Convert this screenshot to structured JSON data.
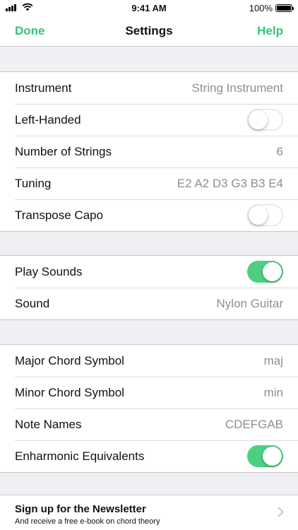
{
  "status_bar": {
    "time": "9:41 AM",
    "battery": "100%"
  },
  "nav": {
    "done": "Done",
    "title": "Settings",
    "help": "Help",
    "accent_color": "#2fc778"
  },
  "section1": {
    "instrument": {
      "label": "Instrument",
      "value": "String Instrument"
    },
    "left_handed": {
      "label": "Left-Handed",
      "on": false
    },
    "strings": {
      "label": "Number of Strings",
      "value": "6"
    },
    "tuning": {
      "label": "Tuning",
      "value": "E2 A2 D3 G3 B3 E4"
    },
    "transpose_capo": {
      "label": "Transpose Capo",
      "on": false
    }
  },
  "section2": {
    "play_sounds": {
      "label": "Play Sounds",
      "on": true
    },
    "sound": {
      "label": "Sound",
      "value": "Nylon Guitar"
    }
  },
  "section3": {
    "major": {
      "label": "Major Chord Symbol",
      "value": "maj"
    },
    "minor": {
      "label": "Minor Chord Symbol",
      "value": "min"
    },
    "note_names": {
      "label": "Note Names",
      "value": "CDEFGAB"
    },
    "enharmonic": {
      "label": "Enharmonic Equivalents",
      "on": true
    }
  },
  "section4": {
    "newsletter_title": "Sign up for the Newsletter",
    "newsletter_subtitle": "And receive a free e-book on chord theory",
    "icon": "chevron-right-icon"
  }
}
